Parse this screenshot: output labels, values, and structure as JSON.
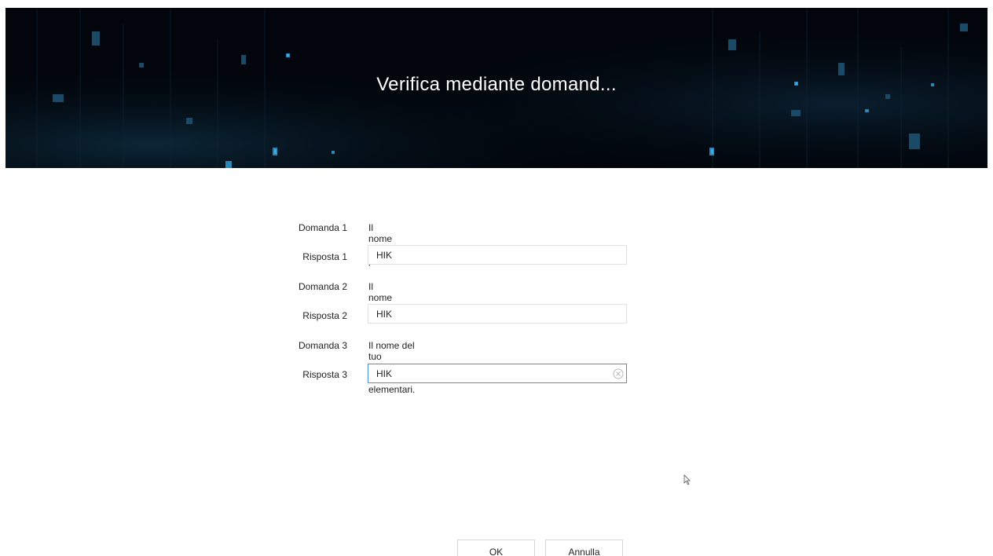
{
  "header": {
    "title": "Verifica mediante domand..."
  },
  "questions": [
    {
      "question_label": "Domanda 1",
      "question_text": "Il nome di tuo padre.",
      "answer_label": "Risposta 1",
      "answer_value": "HIK"
    },
    {
      "question_label": "Domanda 2",
      "question_text": "Il nome di tua madre.",
      "answer_label": "Risposta 2",
      "answer_value": "HIK"
    },
    {
      "question_label": "Domanda 3",
      "question_text": "Il nome del tuo insegnante delle elementari.",
      "answer_label": "Risposta 3",
      "answer_value": "HIK"
    }
  ],
  "buttons": {
    "ok_label": "OK",
    "cancel_label": "Annulla"
  },
  "icons": {
    "clear": "clear-circle-x-icon",
    "cursor": "mouse-pointer-icon"
  },
  "colors": {
    "banner_bg": "#02060c",
    "focus_border": "#4a90d9",
    "field_border": "#e2e2e2"
  }
}
